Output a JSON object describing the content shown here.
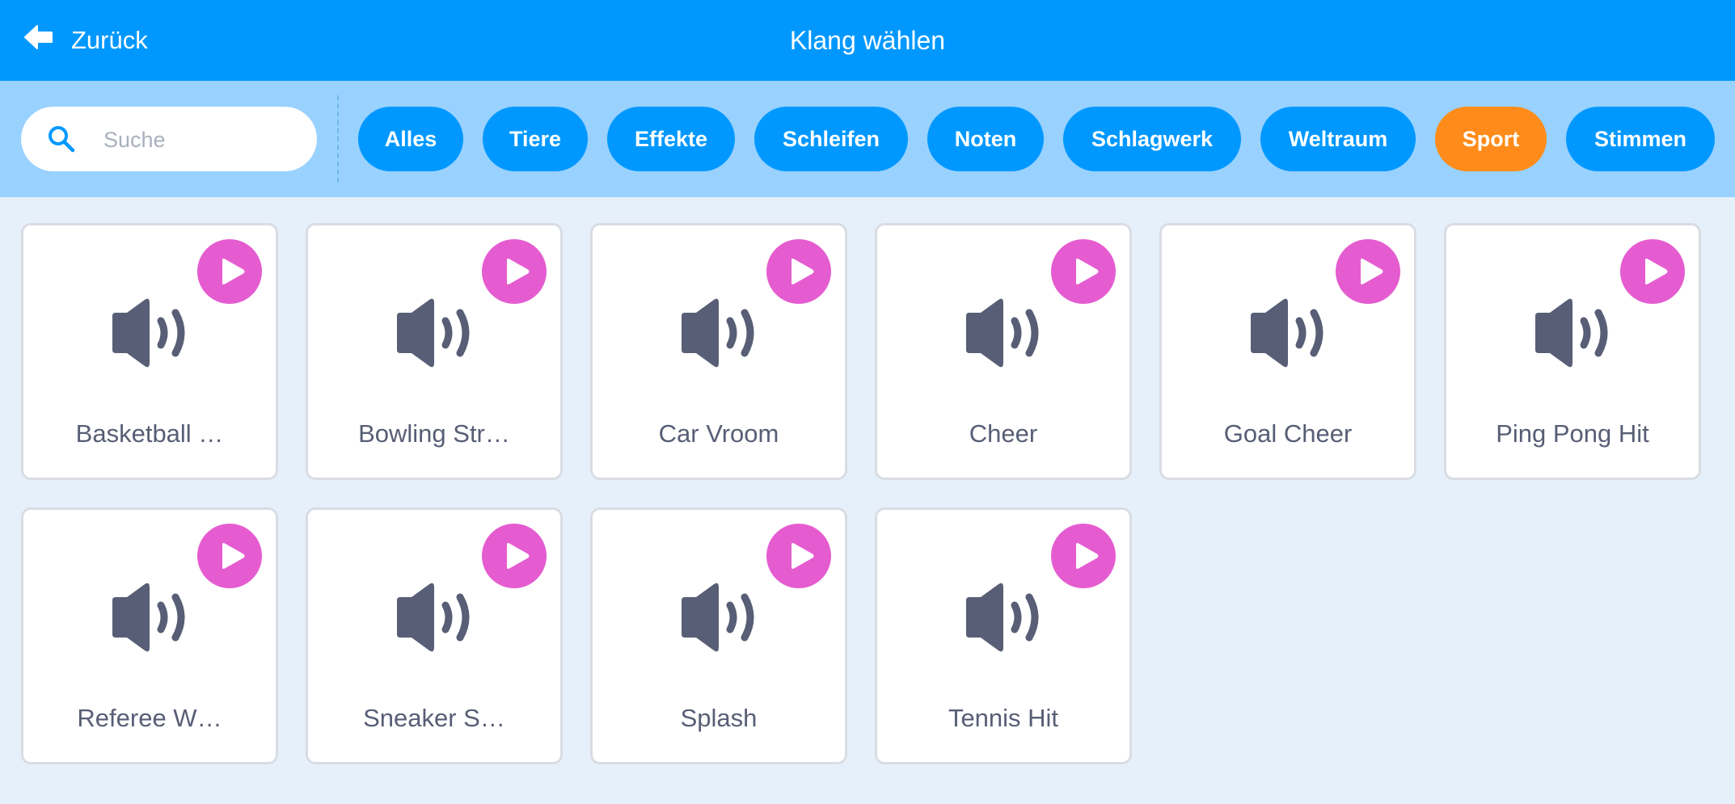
{
  "header": {
    "back_label": "Zurück",
    "title": "Klang wählen"
  },
  "search": {
    "placeholder": "Suche",
    "value": ""
  },
  "tags": [
    {
      "label": "Alles",
      "active": false
    },
    {
      "label": "Tiere",
      "active": false
    },
    {
      "label": "Effekte",
      "active": false
    },
    {
      "label": "Schleifen",
      "active": false
    },
    {
      "label": "Noten",
      "active": false
    },
    {
      "label": "Schlagwerk",
      "active": false
    },
    {
      "label": "Weltraum",
      "active": false
    },
    {
      "label": "Sport",
      "active": true
    },
    {
      "label": "Stimmen",
      "active": false
    }
  ],
  "sounds": [
    {
      "name": "Basketball …"
    },
    {
      "name": "Bowling Str…"
    },
    {
      "name": "Car Vroom"
    },
    {
      "name": "Cheer"
    },
    {
      "name": "Goal Cheer"
    },
    {
      "name": "Ping Pong Hit"
    },
    {
      "name": "Referee W…"
    },
    {
      "name": "Sneaker S…"
    },
    {
      "name": "Splash"
    },
    {
      "name": "Tennis Hit"
    }
  ],
  "colors": {
    "header": "#0098ff",
    "filterbar": "#99d1ff",
    "tag": "#0098ff",
    "tag_active": "#ff8c1a",
    "play_button": "#e55cd0",
    "speaker_icon": "#575e75",
    "background": "#e6f0fa"
  },
  "icons": {
    "back": "arrow-left-icon",
    "search": "search-icon",
    "play": "play-icon",
    "sound": "speaker-icon"
  }
}
